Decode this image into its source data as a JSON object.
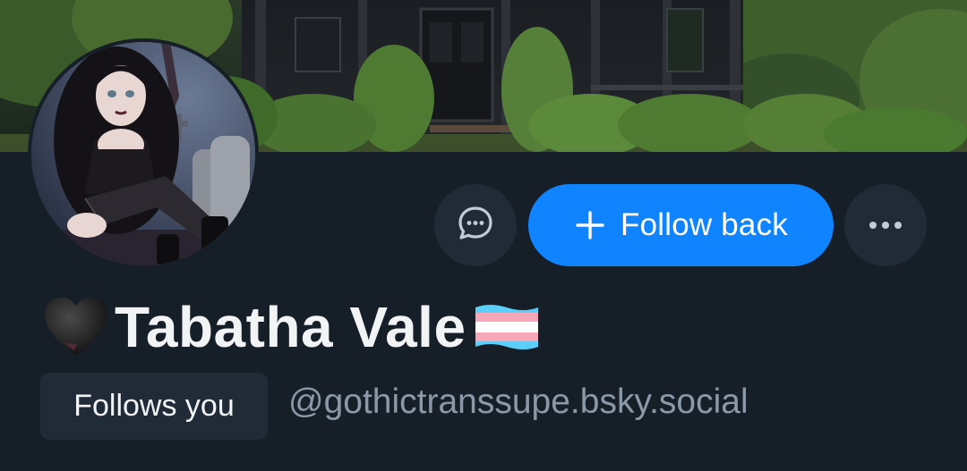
{
  "profile": {
    "display_name": "Tabatha Vale",
    "name_prefix_icon": "black-heart-icon",
    "name_suffix_icon": "transgender-flag-icon",
    "handle": "@gothictranssupe.bsky.social",
    "follows_you_label": "Follows you"
  },
  "actions": {
    "message_icon": "chat-bubble-icon",
    "follow_label": "Follow back",
    "follow_icon": "plus-icon",
    "more_icon": "ellipsis-icon"
  },
  "colors": {
    "background": "#161e27",
    "accent": "#1083fe",
    "secondary_button": "#202b37",
    "handle_text": "#8b98a8",
    "primary_text": "#f1f3f5"
  }
}
